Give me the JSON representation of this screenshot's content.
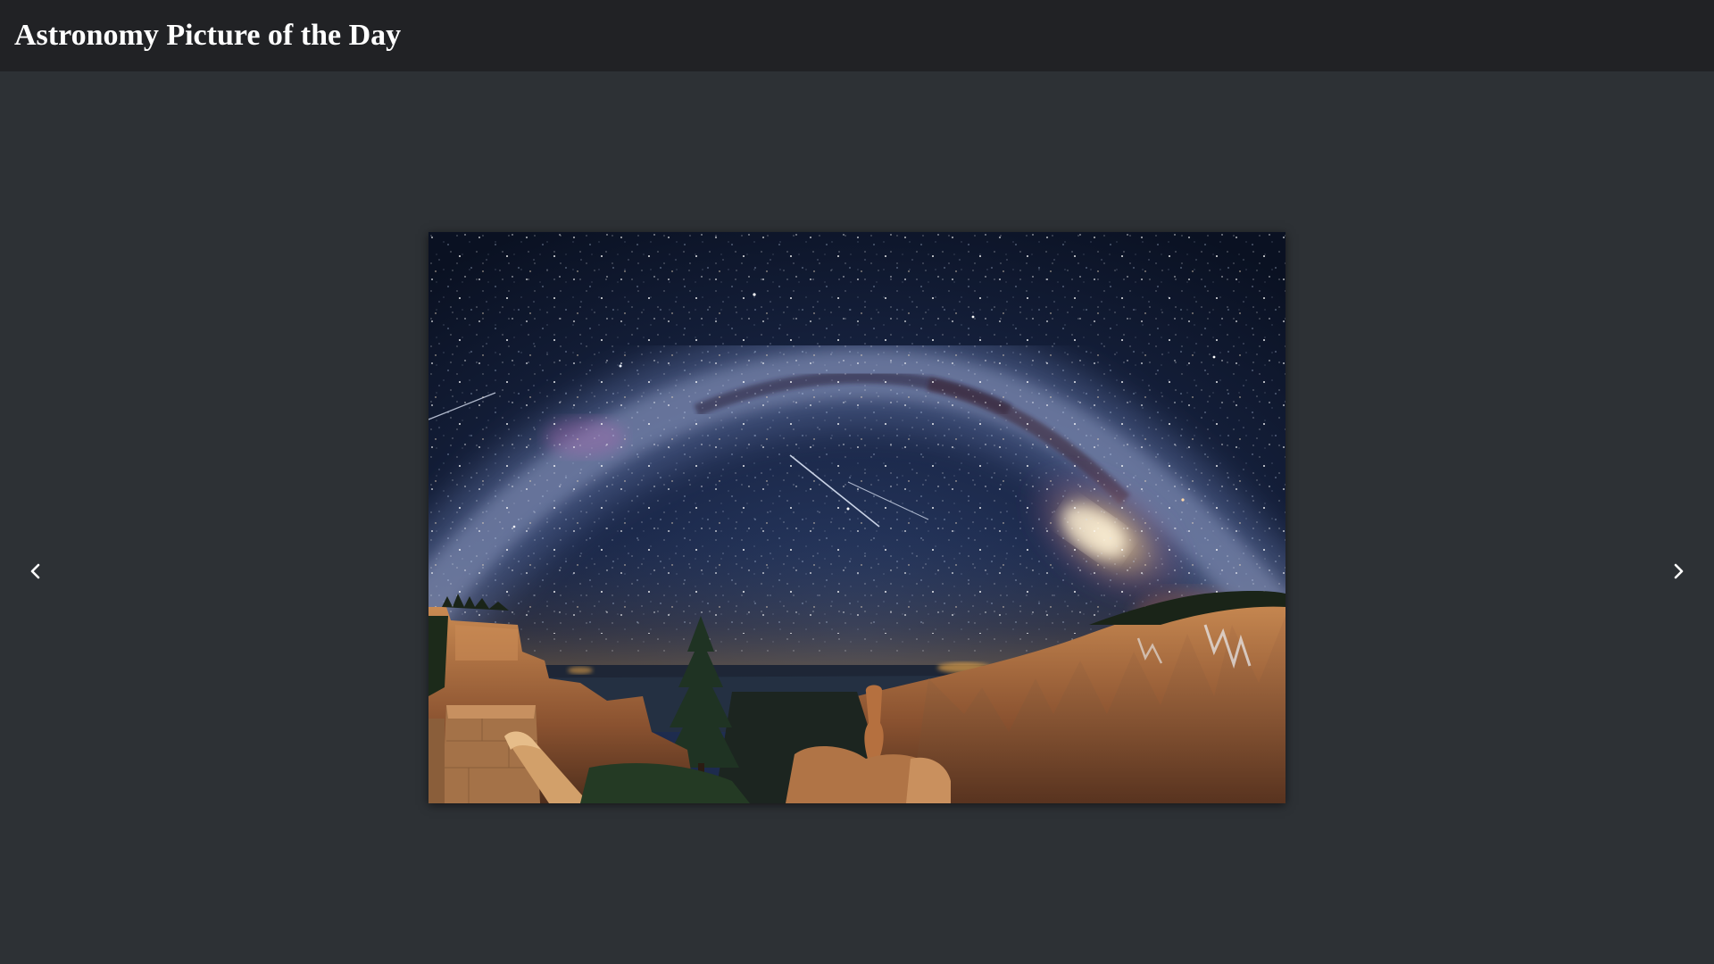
{
  "header": {
    "title": "Astronomy Picture of the Day"
  },
  "carousel": {
    "prev_icon": "chevron-left-icon",
    "next_icon": "chevron-right-icon"
  },
  "photo": {
    "subject": "milky-way-arch-over-canyon-hoodoos"
  },
  "colors": {
    "header_bg": "#212225",
    "page_bg": "#2d3135",
    "title_text": "#ffffff",
    "arrow": "#ffffff"
  }
}
